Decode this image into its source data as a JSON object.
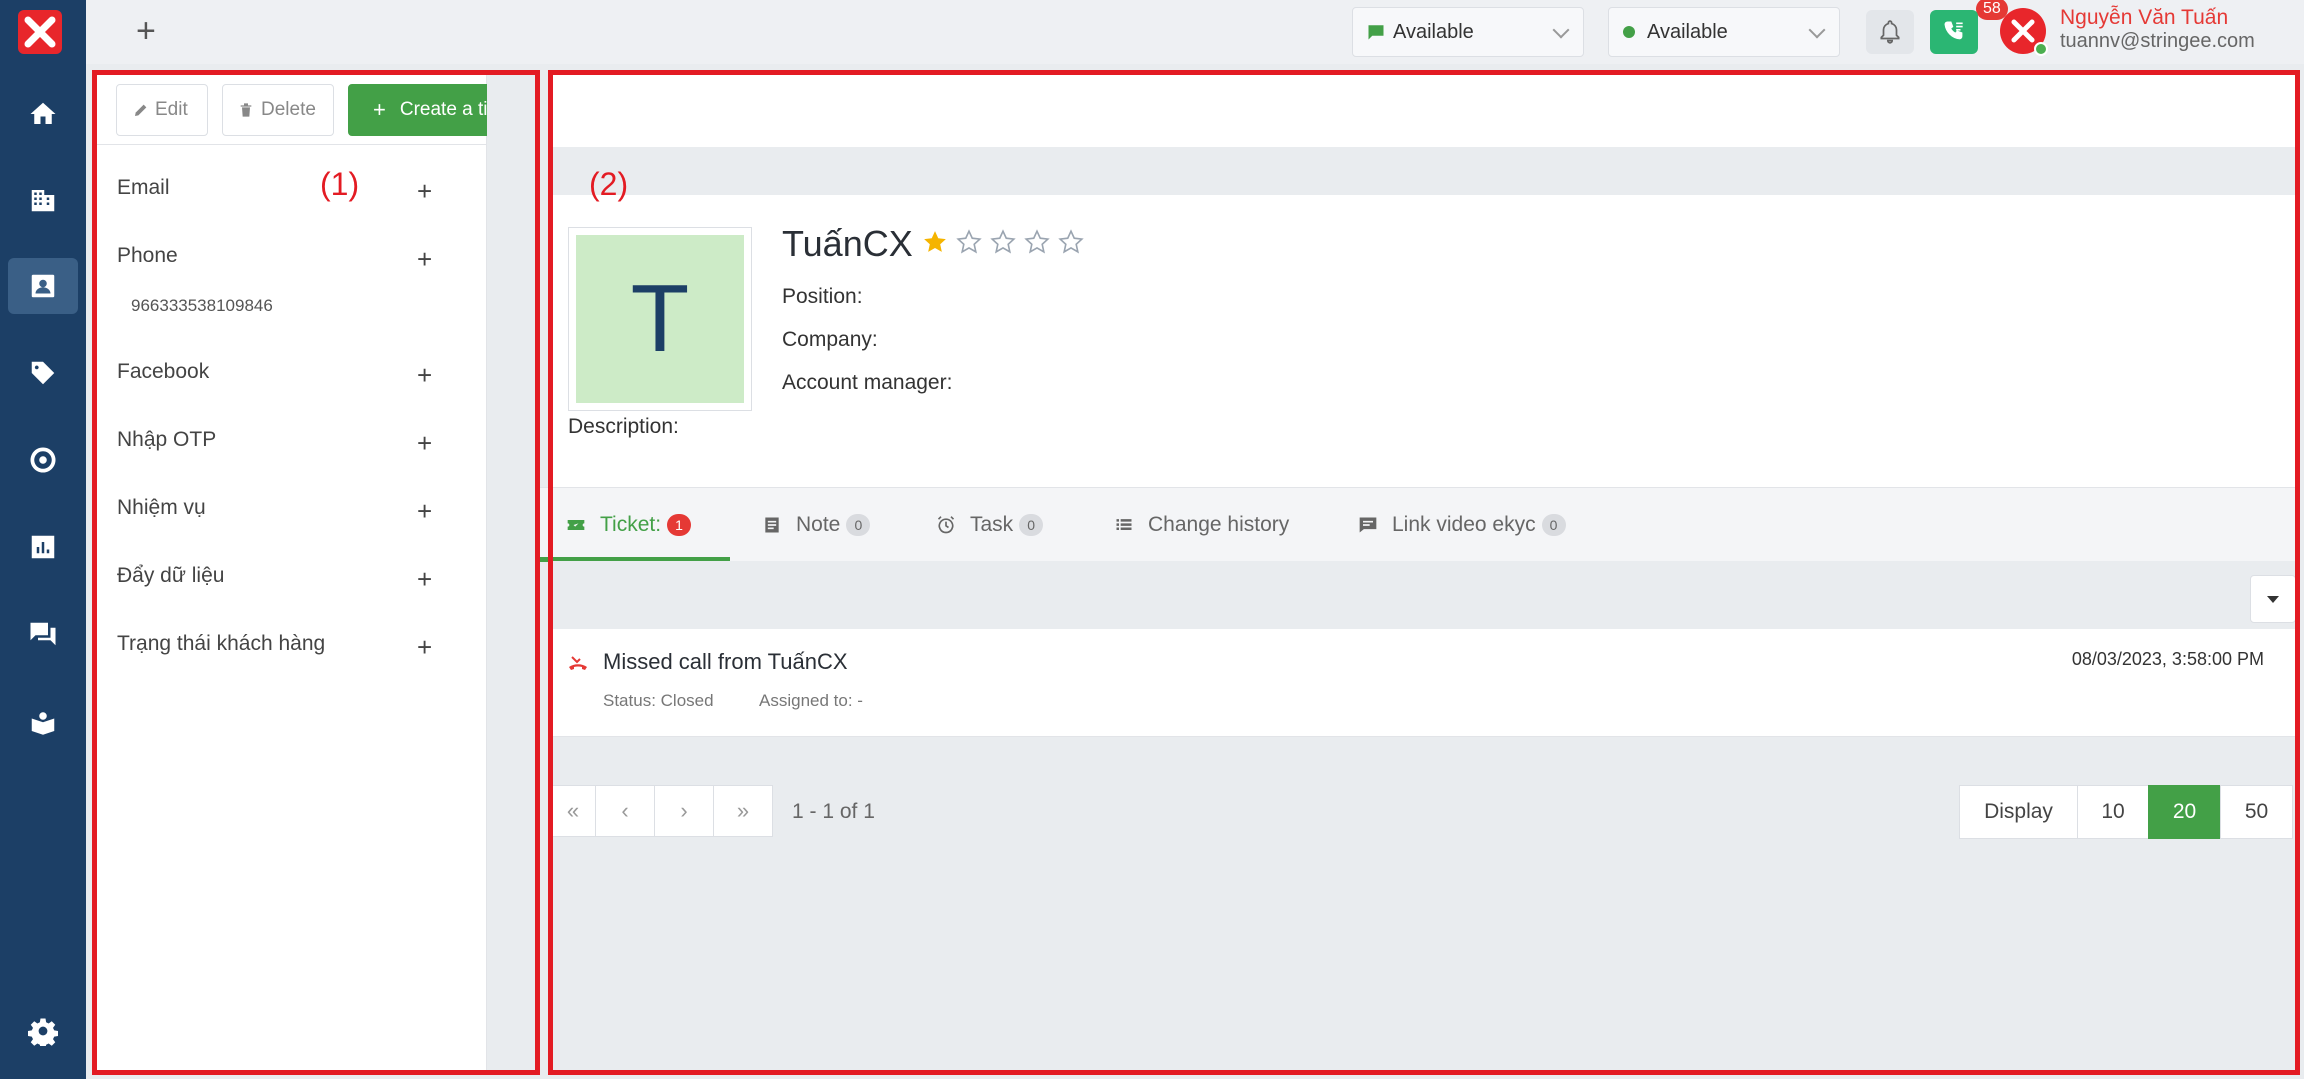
{
  "nav": {
    "items": [
      {
        "icon": "home-icon"
      },
      {
        "icon": "building-icon"
      },
      {
        "icon": "contact-card-icon"
      },
      {
        "icon": "tag-icon"
      },
      {
        "icon": "target-icon"
      },
      {
        "icon": "chart-icon"
      },
      {
        "icon": "chat-icon"
      },
      {
        "icon": "book-icon"
      },
      {
        "icon": "gear-icon"
      }
    ]
  },
  "topbar": {
    "plus": "+",
    "status1": "Available",
    "status2": "Available",
    "notification_count": "58",
    "user_name": "Nguyễn Văn Tuấn",
    "user_email": "tuannv@stringee.com"
  },
  "left_panel": {
    "edit": "Edit",
    "delete": "Delete",
    "create_ticket": "Create a ticket",
    "fields": [
      {
        "label": "Email"
      },
      {
        "label": "Phone",
        "value": "966333538109846"
      },
      {
        "label": "Facebook"
      },
      {
        "label": "Nhập OTP"
      },
      {
        "label": "Nhiệm vụ"
      },
      {
        "label": "Đẩy dữ liệu"
      },
      {
        "label": "Trạng thái khách hàng"
      }
    ],
    "plus": "+"
  },
  "profile": {
    "avatar_letter": "T",
    "name": "TuấnCX",
    "rating": 1,
    "rating_max": 5,
    "position_label": "Position:",
    "company_label": "Company:",
    "account_manager_label": "Account manager:",
    "description_label": "Description:"
  },
  "tabs": [
    {
      "label": "Ticket:",
      "count": "1",
      "active": true
    },
    {
      "label": "Note",
      "count": "0"
    },
    {
      "label": "Task",
      "count": "0"
    },
    {
      "label": "Change history"
    },
    {
      "label": "Link video ekyc",
      "count": "0"
    }
  ],
  "ticket": {
    "title": "Missed call from TuấnCX",
    "time": "08/03/2023, 3:58:00 PM",
    "status": "Status: Closed",
    "assigned": "Assigned to: -"
  },
  "pagination": {
    "info": "1 - 1 of 1",
    "display_label": "Display",
    "sizes": [
      "10",
      "20",
      "50"
    ],
    "selected": "20"
  },
  "annotations": {
    "label1": "(1)",
    "label2": "(2)"
  },
  "colors": {
    "nav_bg": "#1c3f66",
    "accent_green": "#43a047",
    "annotation_red": "#e31b23"
  }
}
